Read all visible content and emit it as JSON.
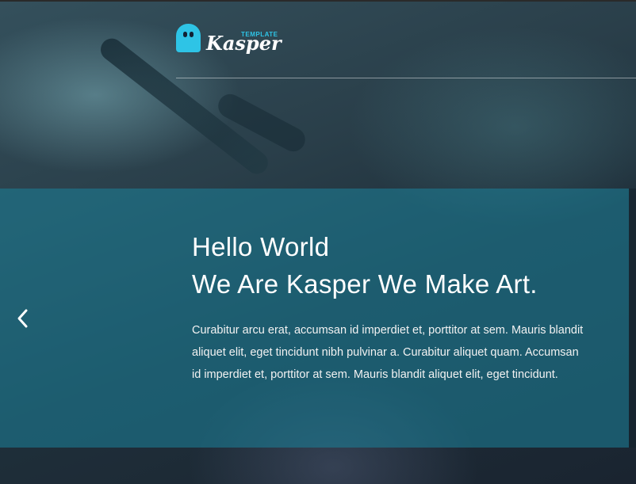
{
  "brand": {
    "logo_template": "TEMPLATE",
    "logo_name": "Kasper",
    "accent_color": "#2ec4e6"
  },
  "hero": {
    "title": "Hello World",
    "subtitle": "We Are Kasper We Make Art.",
    "description": "Curabitur arcu erat, accumsan id imperdiet et, porttitor at sem. Mauris blandit aliquet elit, eget tincidunt nibh pulvinar a. Curabitur aliquet quam. Accumsan id imperdiet et, porttitor at sem. Mauris blandit aliquet elit, eget tincidunt.",
    "overlay_color": "#1b7d96"
  },
  "controls": {
    "prev_icon": "chevron-left-icon"
  }
}
